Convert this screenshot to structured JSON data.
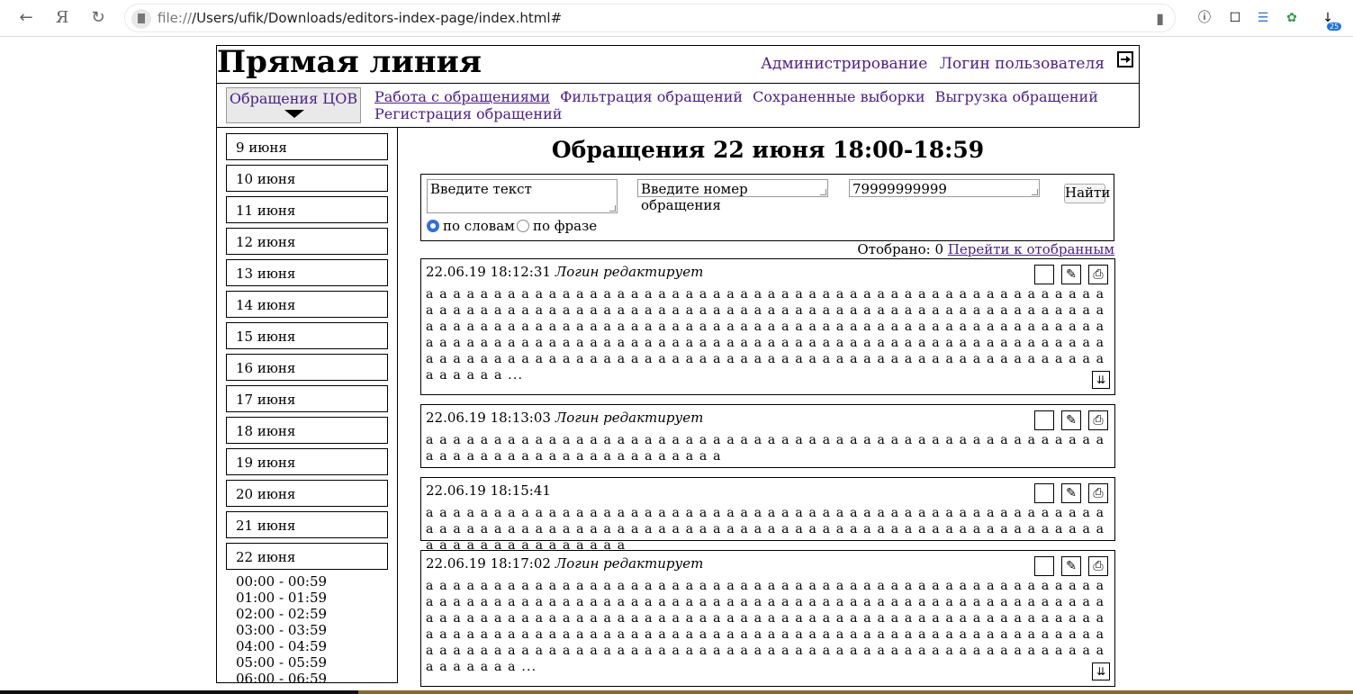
{
  "browser": {
    "url_prefix": "file://",
    "url_path": "/Users/ufik/Downloads/editors-index-page/index.html#",
    "back_icon": "back-arrow-icon",
    "download_badge": "25"
  },
  "header": {
    "brand": "Прямая линия",
    "admin_link": "Администрирование",
    "user_link": "Логин пользователя",
    "dropdown_label": "Обращения ЦОВ",
    "menu": [
      "Работа с обращениями",
      "Фильтрация обращений",
      "Сохраненные выборки",
      "Выгрузка обращений",
      "Регистрация обращений"
    ]
  },
  "sidebar": {
    "days": [
      "9 июня",
      "10 июня",
      "11 июня",
      "12 июня",
      "13 июня",
      "14 июня",
      "15 июня",
      "16 июня",
      "17 июня",
      "18 июня",
      "19 июня",
      "20 июня",
      "21 июня",
      "22 июня"
    ],
    "hours": [
      "00:00 - 00:59",
      "01:00 - 01:59",
      "02:00 - 02:59",
      "03:00 - 03:59",
      "04:00 - 04:59",
      "05:00 - 05:59",
      "06:00 - 06:59"
    ]
  },
  "main": {
    "title": "Обращения 22 июня 18:00-18:59",
    "search": {
      "text_placeholder": "Введите текст",
      "number_placeholder": "Введите номер обращения",
      "phone_value": "79999999999",
      "find_label": "Найти",
      "radio_words": "по словам",
      "radio_phrase": "по фразе"
    },
    "selected_label": "Отобрано: 0",
    "selected_link": "Перейти к отобранным",
    "messages": [
      {
        "time": "22.06.19 18:12:31",
        "editor": "Логин редактирует",
        "text": "a a a a a a a a a a a a a a a a a a a a a a a a a a a a a a a a a a a a a a a a a a a a a a a a a a a a a a a a a a a a a a a a a a a a a a a a a a a a a a a a a a a a a a a a a a a a a a a a a a a a a a a a a a a a a a a a a a a a a a a a a a a a a a a a a a a a a a a a a a a a a a a a a a a a a a a a a a a a a a a a a a a a a a a a a a a a a a a a a a a a a a a a a a a a a a a a a a a a a a a a a a a a a a a a a a a a a a a a a a a a a a a a a a a a a a a a a a a a a a a a a a a a a a a a a a a a a a a a ..."
      },
      {
        "time": "22.06.19 18:13:03",
        "editor": "Логин редактирует",
        "text": "a a a a a a a a a a a a a a a a a a a a a a a a a a a a a a a a a a a a a a a a a a a a a a a a a a a a a a a a a a a a a a a a a a a a a a a a"
      },
      {
        "time": "22.06.19 18:15:41",
        "editor": "",
        "text": "a a a a a a a a a a a a a a a a a a a a a a a a a a a a a a a a a a a a a a a a a a a a a a a a a a a a a a a a a a a a a a a a a a a a a a a a a a a a a a a a a a a a a a a a a a a a a a a a a a a a a a a a a a a a a a a a a a a"
      },
      {
        "time": "22.06.19 18:17:02",
        "editor": "Логин редактирует",
        "text": "a a a a a a a a a a a a a a a a a a a a a a a a a a a a a a a a a a a a a a a a a a a a a a a a a a a a a a a a a a a a a a a a a a a a a a a a a a a a a a a a a a a a a a a a a a a a a a a a a a a a a a a a a a a a a a a a a a a a a a a a a a a a a a a a a a a a a a a a a a a a a a a a a a a a a a a a a a a a a a a a a a a a a a a a a a a a a a a a a a a a a a a a a a a a a a a a a a a a a a a a a a a a a a a a a a a a a a a a a a a a a a a a a a a a a a a a a a a a a a a a a a a a a a a a a a a a a a a a a ..."
      }
    ]
  }
}
